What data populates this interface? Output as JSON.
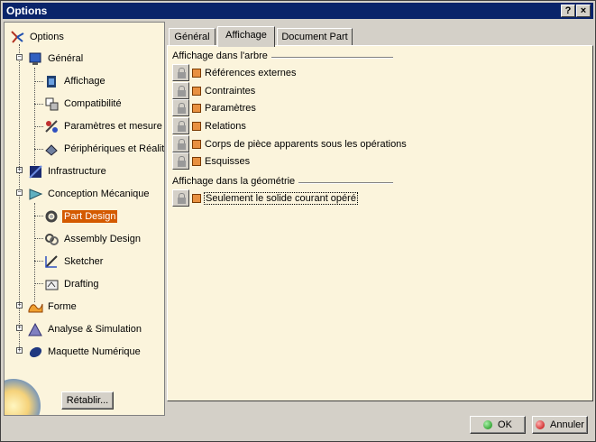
{
  "window": {
    "title": "Options",
    "help_label": "?",
    "close_label": "×"
  },
  "tree": {
    "root": {
      "label": "Options",
      "icon": "options-tree-icon"
    },
    "items": [
      {
        "label": "Général",
        "icon": "general-icon"
      },
      {
        "label": "Affichage",
        "icon": "display-icon"
      },
      {
        "label": "Compatibilité",
        "icon": "compatibility-icon"
      },
      {
        "label": "Paramètres et mesure",
        "icon": "parameters-icon"
      },
      {
        "label": "Périphériques et Réalité V",
        "icon": "devices-icon"
      },
      {
        "label": "Infrastructure",
        "icon": "infrastructure-icon"
      },
      {
        "label": "Conception Mécanique",
        "icon": "mechanical-design-icon"
      },
      {
        "label": "Part Design",
        "icon": "part-design-icon",
        "selected": true
      },
      {
        "label": "Assembly Design",
        "icon": "assembly-design-icon"
      },
      {
        "label": "Sketcher",
        "icon": "sketcher-icon"
      },
      {
        "label": "Drafting",
        "icon": "drafting-icon"
      },
      {
        "label": "Forme",
        "icon": "shape-icon"
      },
      {
        "label": "Analyse & Simulation",
        "icon": "analysis-icon"
      },
      {
        "label": "Maquette Numérique",
        "icon": "digital-mockup-icon"
      }
    ],
    "reset_label": "Rétablir..."
  },
  "tabs": [
    {
      "label": "Général"
    },
    {
      "label": "Affichage",
      "active": true
    },
    {
      "label": "Document Part"
    }
  ],
  "panel": {
    "tree_group": {
      "title": "Affichage dans l'arbre",
      "options": [
        {
          "label": "Références externes",
          "checked": true
        },
        {
          "label": "Contraintes",
          "checked": true
        },
        {
          "label": "Paramètres",
          "checked": true
        },
        {
          "label": "Relations",
          "checked": true
        },
        {
          "label": "Corps de pièce apparents sous les opérations",
          "checked": true
        },
        {
          "label": "Esquisses",
          "checked": true
        }
      ]
    },
    "geometry_group": {
      "title": "Affichage dans la géométrie",
      "options": [
        {
          "label": "Seulement le solide courant opéré",
          "checked": true
        }
      ]
    }
  },
  "footer": {
    "ok_label": "OK",
    "cancel_label": "Annuler"
  },
  "colors": {
    "titlebar": "#0a246a",
    "panel_bg": "#fbf4dc",
    "selection": "#d45a00"
  }
}
